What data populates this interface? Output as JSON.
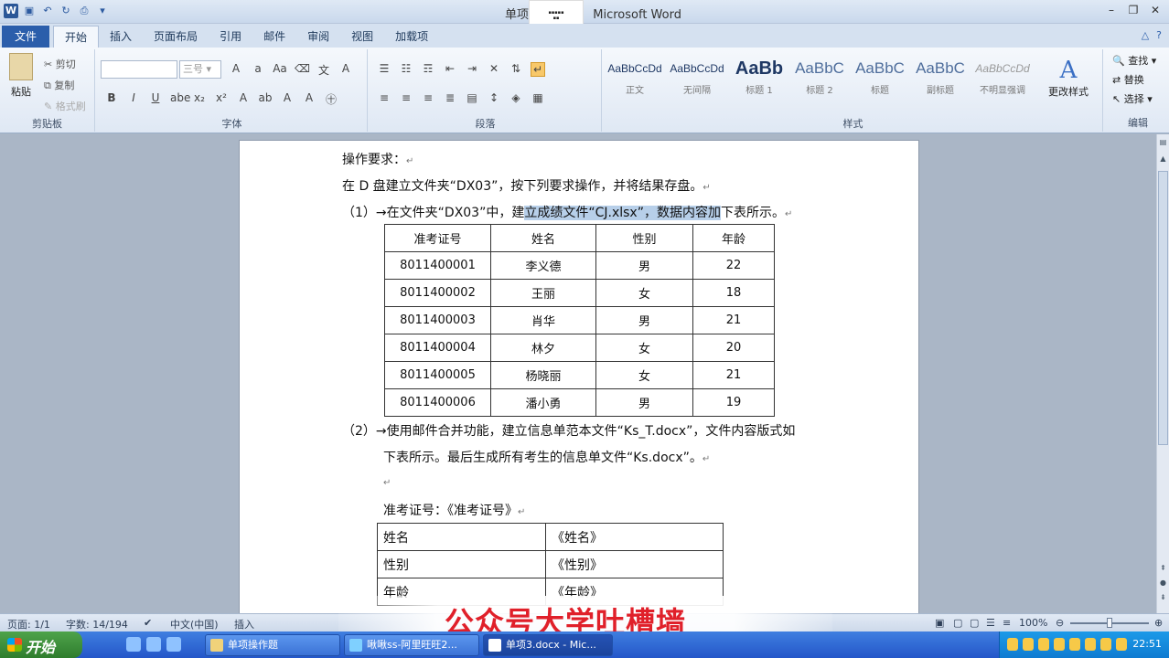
{
  "window": {
    "title": "单项3.docx - Microsoft Word",
    "title_visible": "单项",
    "title_suffix": "Microsoft Word"
  },
  "ribbon_tabs": [
    "文件",
    "开始",
    "插入",
    "页面布局",
    "引用",
    "邮件",
    "审阅",
    "视图",
    "加载项"
  ],
  "clipboard": {
    "paste": "粘贴",
    "cut": "剪切",
    "copy": "复制",
    "format_painter": "格式刷",
    "label": "剪贴板"
  },
  "font": {
    "size": "三号",
    "label": "字体"
  },
  "paragraph": {
    "label": "段落"
  },
  "styles": {
    "items": [
      {
        "sample": "AaBbCcDd",
        "name": "正文"
      },
      {
        "sample": "AaBbCcDd",
        "name": "无间隔"
      },
      {
        "sample": "AaBb",
        "name": "标题 1"
      },
      {
        "sample": "AaBbC",
        "name": "标题 2"
      },
      {
        "sample": "AaBbC",
        "name": "标题"
      },
      {
        "sample": "AaBbC",
        "name": "副标题"
      },
      {
        "sample": "AaBbCcDd",
        "name": "不明显强调"
      }
    ],
    "change_styles": "更改样式",
    "label": "样式"
  },
  "editing": {
    "find": "查找",
    "replace": "替换",
    "select": "选择",
    "label": "编辑"
  },
  "document": {
    "heading": "操作要求：",
    "intro": "在 D 盘建立文件夹“DX03”，按下列要求操作，并将结果存盘。",
    "step1_prefix": "（1）",
    "step1_a": "在文件夹“DX03”中，建",
    "step1_hl": "立成绩文件“CJ.xlsx”，数据内容加",
    "step1_b": "下表所示。",
    "grade_table": {
      "headers": [
        "准考证号",
        "姓名",
        "性别",
        "年龄"
      ],
      "rows": [
        [
          "8011400001",
          "李义德",
          "男",
          "22"
        ],
        [
          "8011400002",
          "王丽",
          "女",
          "18"
        ],
        [
          "8011400003",
          "肖华",
          "男",
          "21"
        ],
        [
          "8011400004",
          "林夕",
          "女",
          "20"
        ],
        [
          "8011400005",
          "杨晓丽",
          "女",
          "21"
        ],
        [
          "8011400006",
          "潘小勇",
          "男",
          "19"
        ]
      ]
    },
    "step2_prefix": "（2）",
    "step2_line1": "使用邮件合并功能，建立信息单范本文件“Ks_T.docx”，文件内容版式如",
    "step2_line2": "下表所示。最后生成所有考生的信息单文件“Ks.docx”。",
    "exam_id_line": "准考证号：《准考证号》",
    "info_table": [
      [
        "姓名",
        "《姓名》"
      ],
      [
        "性别",
        "《性别》"
      ],
      [
        "年龄",
        "《年龄》"
      ]
    ]
  },
  "statusbar": {
    "page": "页面: 1/1",
    "words": "字数: 14/194",
    "language": "中文(中国)",
    "mode": "插入",
    "zoom": "100%"
  },
  "watermark": "公众号大学吐槽墙",
  "taskbar": {
    "start": "开始",
    "tasks": [
      "单项操作题",
      "啾啾ss-阿里旺旺2...",
      "单项3.docx - Mic..."
    ],
    "clock": "22:51"
  }
}
